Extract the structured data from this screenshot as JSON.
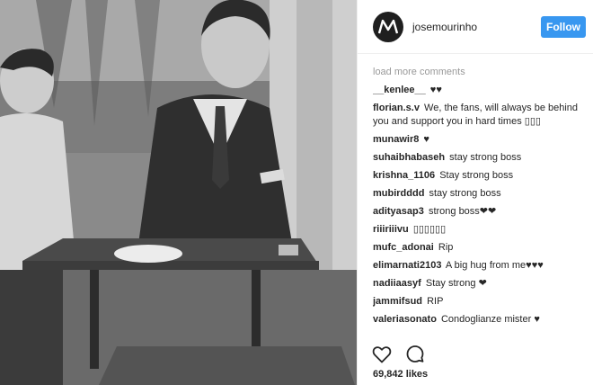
{
  "post": {
    "author": "josemourinho",
    "follow_label": "Follow",
    "likes_text": "69,842 likes"
  },
  "icons": {
    "avatar": "josemourinho-logo-icon",
    "like": "heart-outline-icon",
    "comment": "speech-bubble-icon"
  },
  "colors": {
    "follow_button": "#3897f0",
    "muted_text": "#999999",
    "photo_tone": "grayscale"
  },
  "comments_section": {
    "load_more_label": "load more comments",
    "comments": [
      {
        "author": "__kenlee__",
        "text": "♥♥"
      },
      {
        "author": "florian.s.v",
        "text": "We, the fans, will always be behind you and support you in hard times ▯▯▯"
      },
      {
        "author": "munawir8",
        "text": "♥"
      },
      {
        "author": "suhaibhabaseh",
        "text": "stay strong boss"
      },
      {
        "author": "krishna_1106",
        "text": "Stay strong boss"
      },
      {
        "author": "mubirdddd",
        "text": "stay strong boss"
      },
      {
        "author": "adityasap3",
        "text": "strong boss❤❤"
      },
      {
        "author": "riiiriiivu",
        "text": "▯▯▯▯▯▯"
      },
      {
        "author": "mufc_adonai",
        "text": "Rip"
      },
      {
        "author": "elimarnati2103",
        "text": "A big hug from me♥♥♥"
      },
      {
        "author": "nadiiaasyf",
        "text": "Stay strong ❤"
      },
      {
        "author": "jammifsud",
        "text": "RIP"
      },
      {
        "author": "valeriasonato",
        "text": "Condoglianze mister ♥"
      }
    ]
  }
}
